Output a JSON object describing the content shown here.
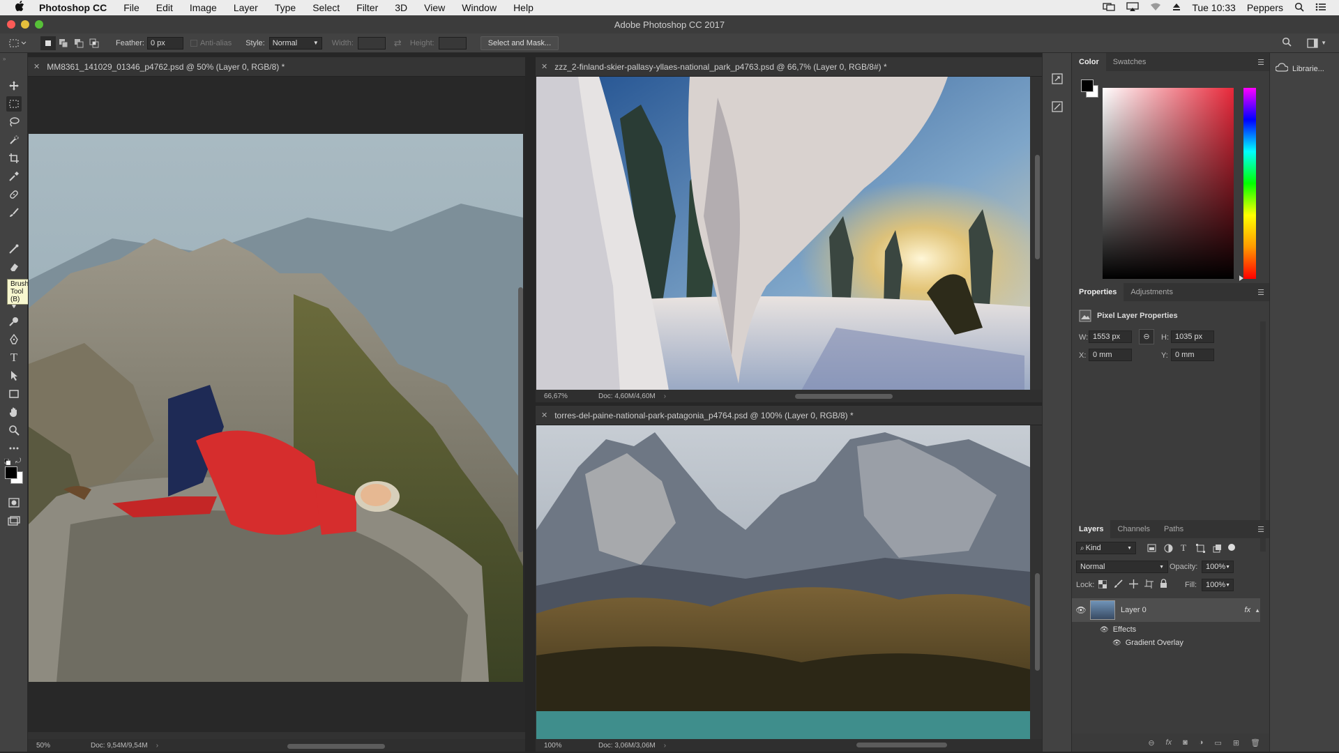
{
  "menubar": {
    "apple": "",
    "items": [
      "Photoshop CC",
      "File",
      "Edit",
      "Image",
      "Layer",
      "Type",
      "Select",
      "Filter",
      "3D",
      "View",
      "Window",
      "Help"
    ],
    "clock": "Tue 10:33",
    "user": "Peppers"
  },
  "window": {
    "title": "Adobe Photoshop CC 2017"
  },
  "options": {
    "feather_label": "Feather:",
    "feather_value": "0 px",
    "antialias_label": "Anti-alias",
    "style_label": "Style:",
    "style_value": "Normal",
    "width_label": "Width:",
    "height_label": "Height:",
    "select_mask_label": "Select and Mask..."
  },
  "tooltip": "Brush Tool (B)",
  "documents": [
    {
      "tab": "MM8361_141029_01346_p4762.psd @ 50% (Layer 0, RGB/8) *",
      "zoom": "50%",
      "doc": "Doc: 9,54M/9,54M"
    },
    {
      "tab": "zzz_2-finland-skier-pallasy-yllaes-national_park_p4763.psd @ 66,7% (Layer 0, RGB/8#) *",
      "zoom": "66,67%",
      "doc": "Doc: 4,60M/4,60M"
    },
    {
      "tab": "torres-del-paine-national-park-patagonia_p4764.psd @ 100% (Layer 0, RGB/8) *",
      "zoom": "100%",
      "doc": "Doc: 3,06M/3,06M"
    }
  ],
  "color_panel": {
    "tabs": [
      "Color",
      "Swatches"
    ]
  },
  "properties_panel": {
    "tabs": [
      "Properties",
      "Adjustments"
    ],
    "heading": "Pixel Layer Properties",
    "w_label": "W:",
    "w_value": "1553 px",
    "h_label": "H:",
    "h_value": "1035 px",
    "x_label": "X:",
    "x_value": "0 mm",
    "y_label": "Y:",
    "y_value": "0 mm"
  },
  "layers_panel": {
    "tabs": [
      "Layers",
      "Channels",
      "Paths"
    ],
    "kind_label": "Kind",
    "blend_mode": "Normal",
    "opacity_label": "Opacity:",
    "opacity_value": "100%",
    "lock_label": "Lock:",
    "fill_label": "Fill:",
    "fill_value": "100%",
    "layers": [
      {
        "name": "Layer 0",
        "effects_label": "Effects",
        "effect": "Gradient Overlay"
      }
    ]
  },
  "libraries": {
    "label": "Librarie..."
  }
}
